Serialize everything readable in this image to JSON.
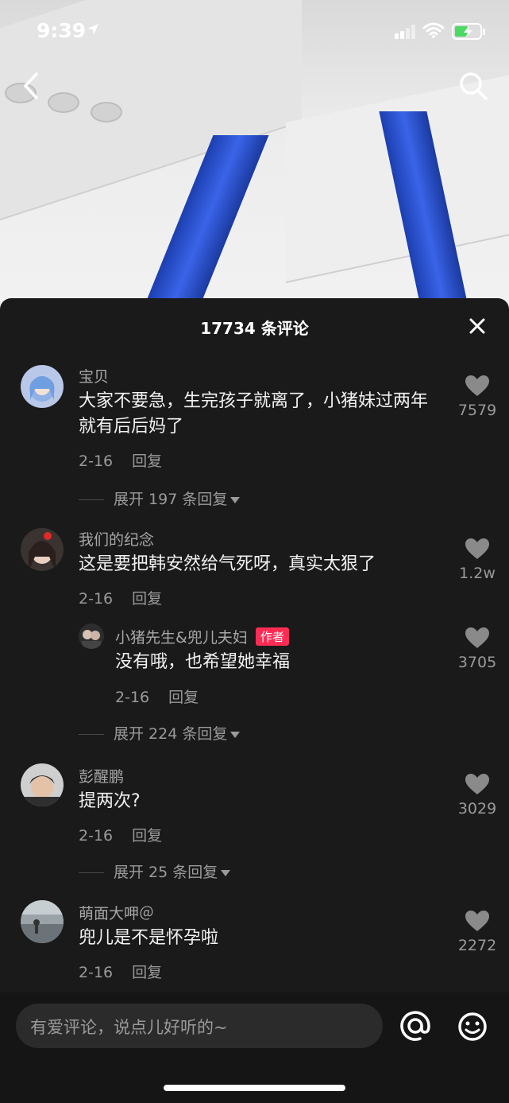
{
  "status_bar": {
    "time": "9:39"
  },
  "sheet": {
    "title": "17734 条评论"
  },
  "comments": [
    {
      "username": "宝贝",
      "text": "大家不要急，生完孩子就离了，小猪妹过两年就有后后妈了",
      "date": "2-16",
      "reply_label": "回复",
      "likes": "7579",
      "expand": "展开 197 条回复"
    },
    {
      "username": "我们的纪念",
      "text": "这是要把韩安然给气死呀，真实太狠了",
      "date": "2-16",
      "reply_label": "回复",
      "likes": "1.2w",
      "sub_reply": {
        "username": "小猪先生&兜儿夫妇",
        "badge": "作者",
        "text": "没有哦，也希望她幸福",
        "date": "2-16",
        "reply_label": "回复",
        "likes": "3705"
      },
      "expand": "展开 224 条回复"
    },
    {
      "username": "彭醒鹏",
      "text": "提两次?",
      "date": "2-16",
      "reply_label": "回复",
      "likes": "3029",
      "expand": "展开 25 条回复"
    },
    {
      "username": "萌面大呷＠",
      "text": "兜儿是不是怀孕啦",
      "date": "2-16",
      "reply_label": "回复",
      "likes": "2272"
    }
  ],
  "input": {
    "placeholder": "有爱评论，说点儿好听的~"
  },
  "colors": {
    "accent": "#fe2c55",
    "background": "#1a1a1a",
    "muted_text": "#9a9a9a"
  }
}
